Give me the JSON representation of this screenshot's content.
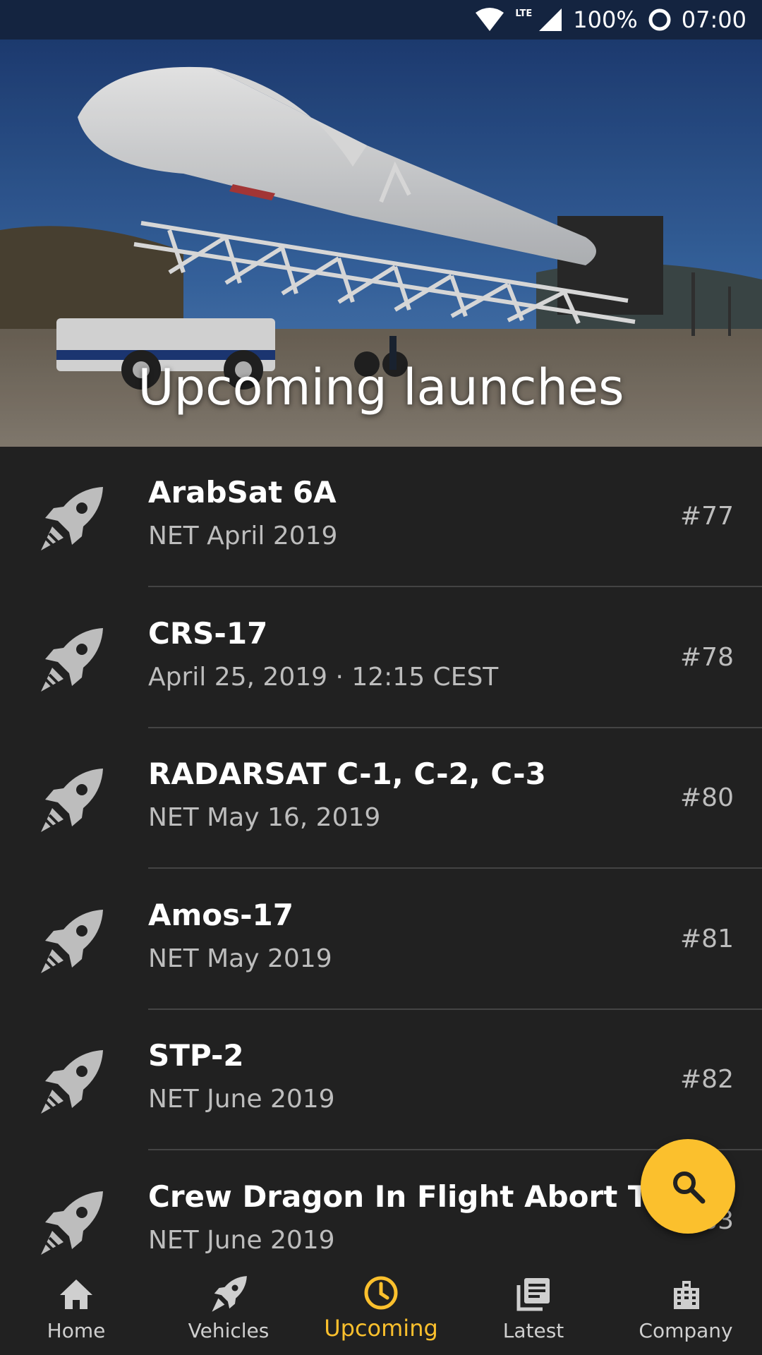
{
  "status_bar": {
    "network": "LTE",
    "battery": "100%",
    "time": "07:00"
  },
  "header": {
    "title": "Upcoming launches"
  },
  "launches": [
    {
      "name": "ArabSat 6A",
      "date": "NET April 2019",
      "number": "#77"
    },
    {
      "name": "CRS-17",
      "date": "April 25, 2019 · 12:15 CEST",
      "number": "#78"
    },
    {
      "name": "RADARSAT C-1, C-2, C-3",
      "date": "NET May 16, 2019",
      "number": "#80"
    },
    {
      "name": "Amos-17",
      "date": "NET May 2019",
      "number": "#81"
    },
    {
      "name": "STP-2",
      "date": "NET June 2019",
      "number": "#82"
    },
    {
      "name": "Crew Dragon In Flight Abort Test",
      "date": "NET June 2019",
      "number": "#83"
    }
  ],
  "fab": {
    "icon": "search-icon"
  },
  "bottom_nav": {
    "items": [
      {
        "label": "Home",
        "icon": "home-icon"
      },
      {
        "label": "Vehicles",
        "icon": "rocket-icon"
      },
      {
        "label": "Upcoming",
        "icon": "clock-icon"
      },
      {
        "label": "Latest",
        "icon": "library-icon"
      },
      {
        "label": "Company",
        "icon": "building-icon"
      }
    ],
    "active": "Upcoming"
  },
  "colors": {
    "accent": "#fbc02d",
    "background": "#212121",
    "status_bar": "#142440",
    "secondary_text": "#bdbdbd"
  }
}
